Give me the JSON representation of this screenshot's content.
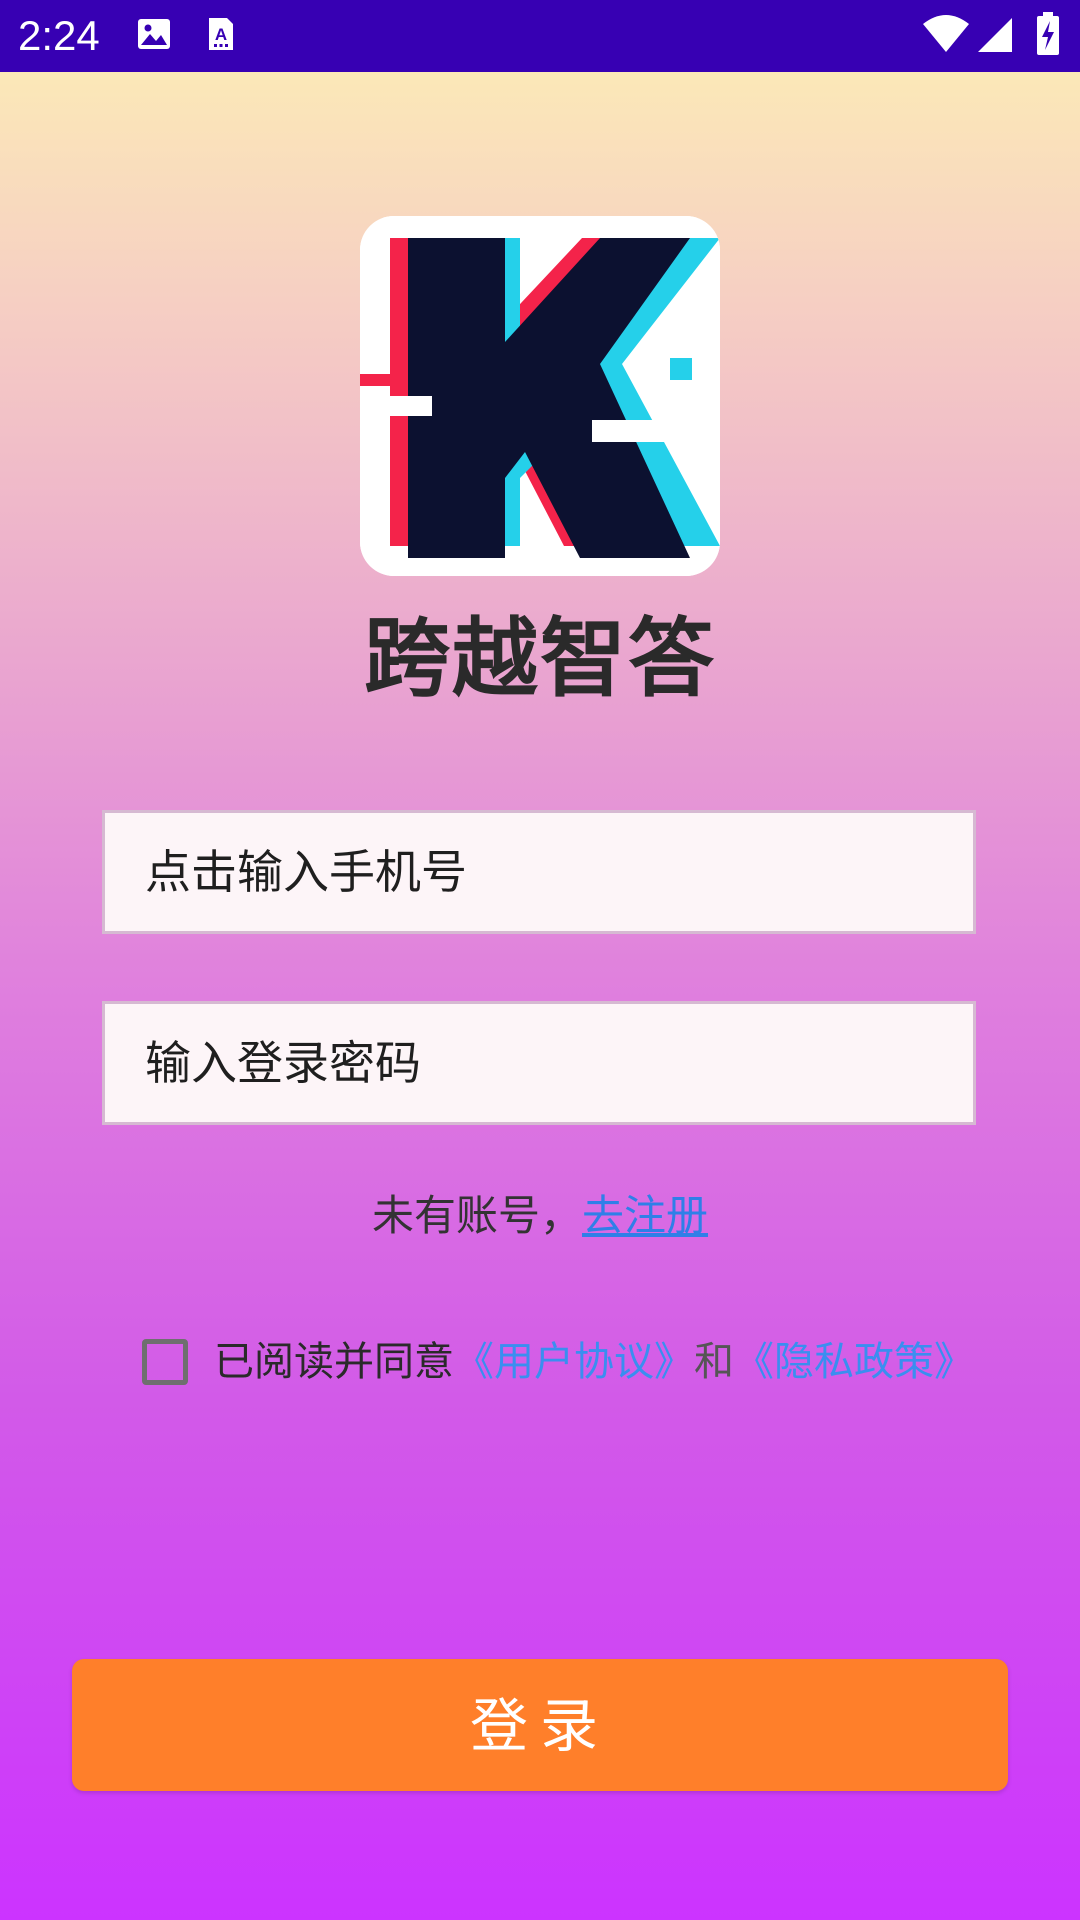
{
  "status_bar": {
    "time": "2:24",
    "icons": [
      "image-icon",
      "a-text-icon",
      "wifi-icon",
      "signal-icon",
      "battery-charging-icon"
    ],
    "background_color": "#3700b3"
  },
  "app": {
    "logo_icon": "k-glitch-logo",
    "title": "跨越智答"
  },
  "login_form": {
    "phone_placeholder": "点击输入手机号",
    "phone_value": "",
    "password_placeholder": "输入登录密码",
    "password_value": ""
  },
  "register": {
    "prompt": "未有账号，",
    "link": "去注册"
  },
  "agreement": {
    "checked": false,
    "prefix": "已阅读并同意",
    "user_agreement": "《用户协议》",
    "and": "和",
    "privacy_policy": "《隐私政策》"
  },
  "login_button": {
    "label": "登录",
    "color": "#ff7f2a"
  },
  "colors": {
    "link": "#2f7fe8",
    "gradient_top": "#fdf0b4",
    "gradient_bottom": "#cc33ff"
  }
}
